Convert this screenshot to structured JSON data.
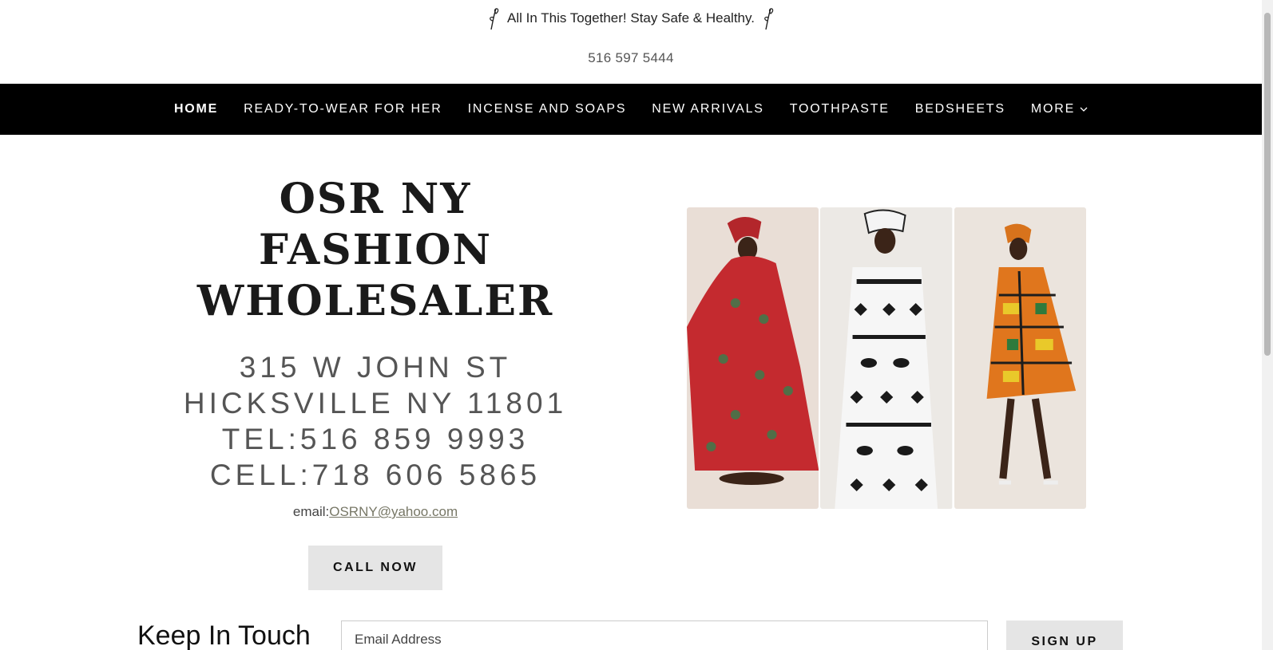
{
  "announcement": {
    "text": "All In This Together! Stay Safe & Healthy."
  },
  "top_phone": "516 597 5444",
  "nav": {
    "items": [
      {
        "label": "HOME"
      },
      {
        "label": "READY-TO-WEAR FOR HER"
      },
      {
        "label": "INCENSE AND SOAPS"
      },
      {
        "label": "NEW ARRIVALS"
      },
      {
        "label": "TOOTHPASTE"
      },
      {
        "label": "BEDSHEETS"
      },
      {
        "label": "MORE"
      }
    ]
  },
  "hero": {
    "brand_line1": "OSR NY FASHION",
    "brand_line2": "WHOLESALER",
    "address_line1": "315 W JOHN ST",
    "address_line2": "HICKSVILLE NY 11801",
    "tel": "TEL:516 859 9993",
    "cell": "CELL:718 606 5865",
    "email_label": "email:",
    "email": "OSRNY@yahoo.com",
    "call_button": "CALL NOW"
  },
  "newsletter": {
    "heading": "Keep In Touch",
    "placeholder": "Email Address",
    "button": "SIGN UP"
  },
  "colors": {
    "nav_bg": "#000000",
    "button_bg": "#e5e5e5",
    "brand_text": "#1a1a1a",
    "address_text": "#555555"
  }
}
